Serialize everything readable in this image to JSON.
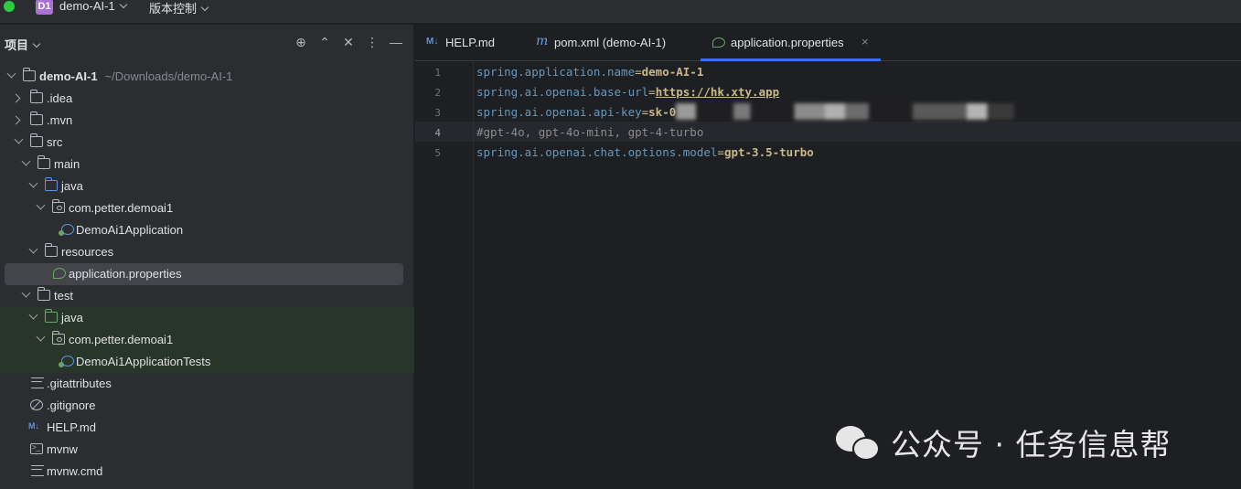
{
  "titlebar": {
    "project_badge": "D1",
    "project_name": "demo-AI-1",
    "vcs_label": "版本控制"
  },
  "sidebar": {
    "title": "项目",
    "tree": [
      {
        "label": "demo-AI-1",
        "sub": "~/Downloads/demo-AI-1"
      },
      {
        "label": ".idea"
      },
      {
        "label": ".mvn"
      },
      {
        "label": "src"
      },
      {
        "label": "main"
      },
      {
        "label": "java"
      },
      {
        "label": "com.petter.demoai1"
      },
      {
        "label": "DemoAi1Application"
      },
      {
        "label": "resources"
      },
      {
        "label": "application.properties"
      },
      {
        "label": "test"
      },
      {
        "label": "java"
      },
      {
        "label": "com.petter.demoai1"
      },
      {
        "label": "DemoAi1ApplicationTests"
      },
      {
        "label": ".gitattributes"
      },
      {
        "label": ".gitignore"
      },
      {
        "label": "HELP.md"
      },
      {
        "label": "mvnw"
      },
      {
        "label": "mvnw.cmd"
      }
    ]
  },
  "tabs": [
    {
      "icon": "M↓",
      "label": "HELP.md"
    },
    {
      "icon": "m",
      "label": "pom.xml (demo-AI-1)"
    },
    {
      "icon": "leaf",
      "label": "application.properties",
      "close": "×"
    }
  ],
  "editor": {
    "line_numbers": [
      "1",
      "2",
      "3",
      "4",
      "5"
    ],
    "current_line": 4,
    "lines": [
      {
        "key": "spring.application.name",
        "eq": "=",
        "value": "demo-AI-1"
      },
      {
        "key": "spring.ai.openai.base-url",
        "eq": "=",
        "value": "https://hk.xty.app"
      },
      {
        "key": "spring.ai.openai.api-key",
        "eq": "=",
        "value": "sk-0"
      },
      {
        "comment": "#gpt-4o, gpt-4o-mini, gpt-4-turbo"
      },
      {
        "key": "spring.ai.openai.chat.options.model",
        "eq": "=",
        "value": "gpt-3.5-turbo"
      }
    ]
  },
  "watermark": {
    "text": "公众号 · 任务信息帮"
  },
  "colors": {
    "background": "#1e1f22",
    "panel": "#2b2d30",
    "accent": "#3574f0",
    "key": "#6897bb",
    "value": "#c9b88a"
  }
}
